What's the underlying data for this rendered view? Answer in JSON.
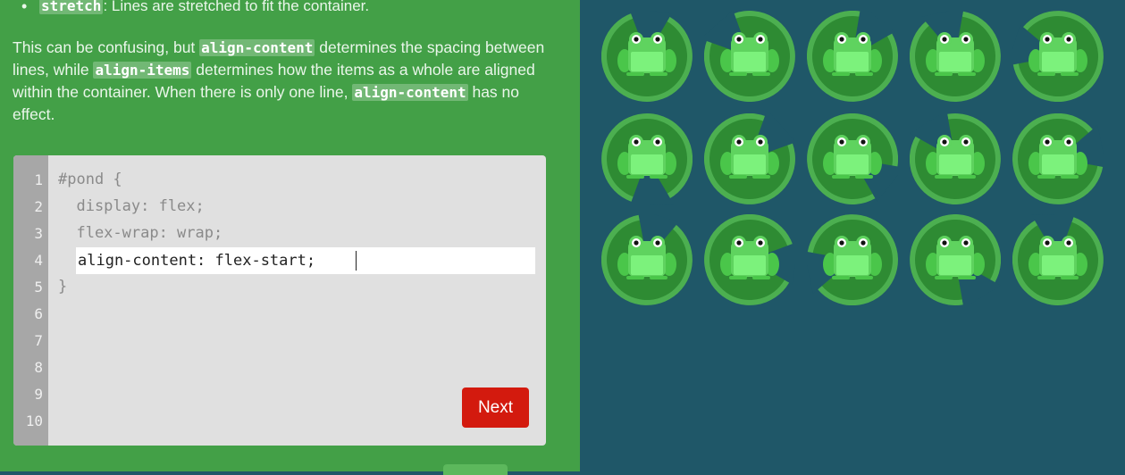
{
  "instructions": {
    "bullet_code": "stretch",
    "bullet_text": ": Lines are stretched to fit the container.",
    "para_part1": "This can be confusing, but ",
    "code_align_content": "align-content",
    "para_part2": " determines the spacing between lines, while ",
    "code_align_items": "align-items",
    "para_part3": " determines how the items as a whole are aligned within the container. When there is only one line, ",
    "code_align_content_2": "align-content",
    "para_part4": " has no effect."
  },
  "editor": {
    "line_numbers": [
      "1",
      "2",
      "3",
      "4",
      "5",
      "6",
      "7",
      "8",
      "9",
      "10"
    ],
    "line1": "#pond {",
    "line2": "  display: flex;",
    "line3": "  flex-wrap: wrap;",
    "input_value": "align-content: flex-start;",
    "line5": "}"
  },
  "buttons": {
    "next_label": "Next"
  },
  "pond": {
    "frog_count": 15,
    "rows": 3,
    "columns": 5,
    "frog_icon": "frog-icon",
    "lilypad_icon": "lilypad-icon",
    "colors": {
      "background": "#1f5768",
      "panel": "#43a047",
      "lilypad_dark": "#2e8b33",
      "lilypad_light": "#4caf50",
      "frog_body": "#5fd35f",
      "frog_belly": "#7cf27c",
      "next_button": "#d31a0e"
    }
  }
}
